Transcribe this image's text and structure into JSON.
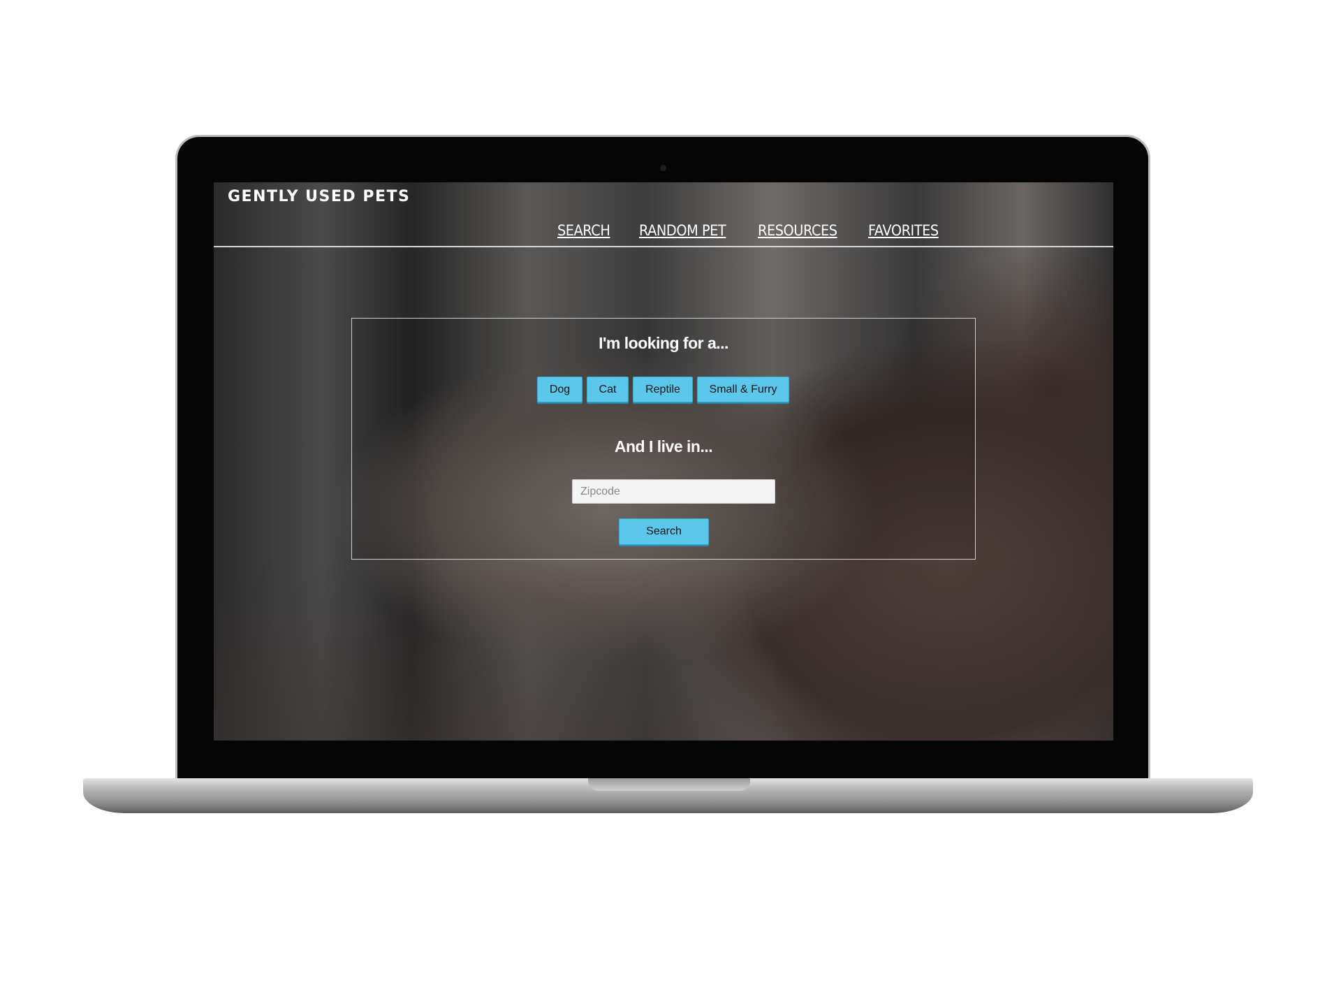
{
  "site": {
    "title": "GENTLY USED PETS"
  },
  "nav": [
    {
      "label": "SEARCH"
    },
    {
      "label": "RANDOM PET"
    },
    {
      "label": "RESOURCES"
    },
    {
      "label": "FAVORITES"
    }
  ],
  "form": {
    "looking_heading": "I'm looking for a...",
    "pet_types": [
      {
        "label": "Dog"
      },
      {
        "label": "Cat"
      },
      {
        "label": "Reptile"
      },
      {
        "label": "Small & Furry"
      }
    ],
    "live_heading": "And I live in...",
    "zip_placeholder": "Zipcode",
    "search_label": "Search"
  },
  "colors": {
    "accent": "#5bc8eb"
  }
}
